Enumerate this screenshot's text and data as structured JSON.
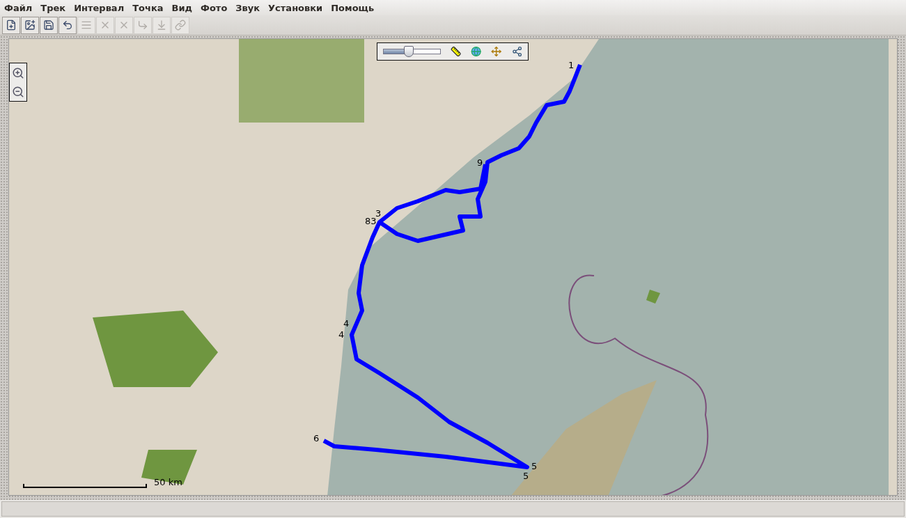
{
  "menu": [
    {
      "label": "Файл"
    },
    {
      "label": "Трек"
    },
    {
      "label": "Интервал"
    },
    {
      "label": "Точка"
    },
    {
      "label": "Вид"
    },
    {
      "label": "Фото"
    },
    {
      "label": "Звук"
    },
    {
      "label": "Установки"
    },
    {
      "label": "Помощь"
    }
  ],
  "toolbar": [
    {
      "kind": "new",
      "disabled": false
    },
    {
      "kind": "photo",
      "disabled": false
    },
    {
      "kind": "save",
      "disabled": false
    },
    {
      "kind": "undo",
      "disabled": false
    },
    {
      "kind": "list",
      "disabled": true
    },
    {
      "kind": "delete",
      "disabled": true
    },
    {
      "kind": "delete-range",
      "disabled": true
    },
    {
      "kind": "start",
      "disabled": true
    },
    {
      "kind": "end",
      "disabled": true
    },
    {
      "kind": "link",
      "disabled": true
    }
  ],
  "map": {
    "zoom_slider": {
      "level": 0.45
    },
    "track_labels": [
      {
        "text": "1"
      },
      {
        "text": "9"
      },
      {
        "text": "3"
      },
      {
        "text": "83"
      },
      {
        "text": "4"
      },
      {
        "text": "4"
      },
      {
        "text": "6"
      },
      {
        "text": "5"
      },
      {
        "text": "5"
      }
    ],
    "scale": {
      "label": "50 km"
    }
  }
}
